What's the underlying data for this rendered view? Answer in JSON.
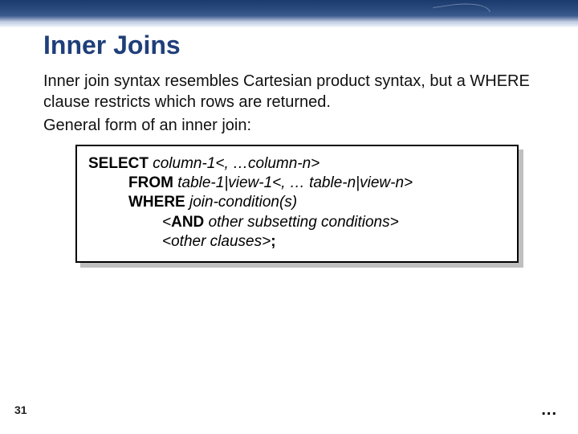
{
  "slide": {
    "title": "Inner Joins",
    "para1": "Inner join syntax resembles Cartesian product syntax, but a WHERE clause restricts which rows are returned.",
    "para2": "General form of an inner join:",
    "page_number": "31",
    "ellipsis": "..."
  },
  "code": {
    "line1_kw": "SELECT ",
    "line1_it": "column-1<, …column-n>",
    "line2_kw": "FROM ",
    "line2_it": "table-1|view-1<, … table-n|view-n>",
    "line3_kw": "WHERE ",
    "line3_it": "join-condition(s)",
    "line4_open": "<",
    "line4_kw": "AND ",
    "line4_it": "other subsetting conditions>",
    "line5_it": "<other clauses>",
    "line5_kw": ";"
  }
}
